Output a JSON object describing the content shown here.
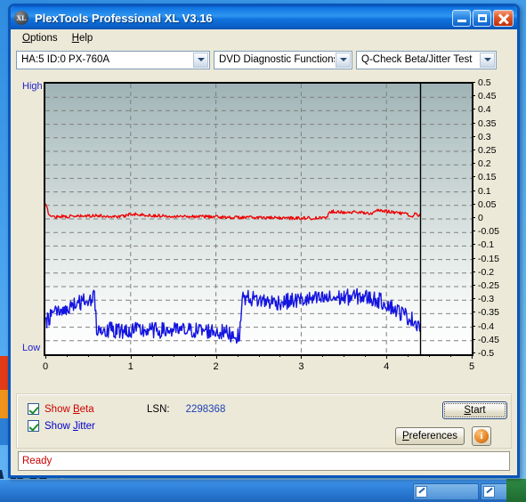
{
  "window": {
    "title": "PlexTools Professional XL V3.16",
    "app_icon": "XL",
    "minimize_title": "Minimize",
    "maximize_title": "Maximize",
    "close_title": "Close"
  },
  "menu": [
    {
      "name": "options",
      "label": "Options",
      "accel": "O"
    },
    {
      "name": "help",
      "label": "Help",
      "accel": "H"
    }
  ],
  "toolbar": {
    "drive_combo": "HA:5 ID:0  PX-760A",
    "function_combo": "DVD Diagnostic Functions",
    "test_combo": "Q-Check Beta/Jitter Test"
  },
  "chart_labels": {
    "high": "High",
    "low": "Low"
  },
  "controls": {
    "show_beta_label": "Show Beta",
    "show_beta_accel": "B",
    "show_beta_checked": true,
    "show_jitter_label": "Show Jitter",
    "show_jitter_accel": "J",
    "show_jitter_checked": true,
    "lsn_label": "LSN:",
    "lsn_value": "2298368",
    "start_label": "Start",
    "start_accel": "S",
    "preferences_label": "Preferences",
    "preferences_accel": "P",
    "info_label": "i"
  },
  "status": {
    "text": "Ready"
  },
  "colors": {
    "beta_trace": "#ee0000",
    "jitter_trace": "#1414e0",
    "axis_label": "#2222cc",
    "title_bar": "#1277e3",
    "status_text": "#cc0000"
  },
  "chart_data": {
    "type": "line",
    "title": "",
    "xlabel": "",
    "ylabel": "",
    "xlim": [
      0,
      5
    ],
    "ylim": [
      -0.5,
      0.5
    ],
    "xticks": [
      0,
      1,
      2,
      3,
      4,
      5
    ],
    "yticks": [
      0.5,
      0.45,
      0.4,
      0.35,
      0.3,
      0.25,
      0.2,
      0.15,
      0.1,
      0.05,
      0,
      -0.05,
      -0.1,
      -0.15,
      -0.2,
      -0.25,
      -0.3,
      -0.35,
      -0.4,
      -0.45,
      -0.5
    ],
    "grid": true,
    "grid_style": "dashed",
    "y_axis_left_labels": [
      "High",
      "Low"
    ],
    "data_end_marker_x": 4.4,
    "series": [
      {
        "name": "Beta",
        "color": "#ee0000",
        "x": [
          0.0,
          0.05,
          0.1,
          0.18,
          0.28,
          0.4,
          0.52,
          0.58,
          0.62,
          0.7,
          0.8,
          0.92,
          1.0,
          1.1,
          1.2,
          1.32,
          1.45,
          1.58,
          1.7,
          1.82,
          1.95,
          2.05,
          2.18,
          2.28,
          2.3,
          2.4,
          2.52,
          2.62,
          2.75,
          2.88,
          3.0,
          3.1,
          3.2,
          3.3,
          3.33,
          3.38,
          3.45,
          3.55,
          3.65,
          3.75,
          3.8,
          3.85,
          3.9,
          3.95,
          4.0,
          4.05,
          4.12,
          4.18,
          4.25,
          4.3,
          4.33,
          4.36,
          4.4
        ],
        "y": [
          0.055,
          0.012,
          0.008,
          0.01,
          0.009,
          0.01,
          0.011,
          0.014,
          0.012,
          0.01,
          0.009,
          0.01,
          0.02,
          0.016,
          0.013,
          0.012,
          0.011,
          0.01,
          0.009,
          0.01,
          0.008,
          0.007,
          0.006,
          0.006,
          0.005,
          0.006,
          0.005,
          0.004,
          0.004,
          0.003,
          0.004,
          0.003,
          0.003,
          0.004,
          0.026,
          0.028,
          0.026,
          0.025,
          0.024,
          0.023,
          0.022,
          0.021,
          0.033,
          0.03,
          0.028,
          0.026,
          0.024,
          0.021,
          0.017,
          0.003,
          0.018,
          0.015,
          0.012
        ],
        "noise_amp": 0.006
      },
      {
        "name": "Jitter",
        "color": "#1414e0",
        "x": [
          0.0,
          0.05,
          0.1,
          0.15,
          0.2,
          0.25,
          0.3,
          0.35,
          0.4,
          0.45,
          0.5,
          0.55,
          0.58,
          0.6,
          0.62,
          0.7,
          0.85,
          1.0,
          1.2,
          1.4,
          1.6,
          1.8,
          1.95,
          2.05,
          2.15,
          2.22,
          2.26,
          2.28,
          2.3,
          2.32,
          2.36,
          2.4,
          2.5,
          2.6,
          2.7,
          2.8,
          2.9,
          3.0,
          3.1,
          3.2,
          3.3,
          3.4,
          3.5,
          3.6,
          3.7,
          3.8,
          3.9,
          4.0,
          4.05,
          4.1,
          4.15,
          4.2,
          4.25,
          4.3,
          4.35,
          4.4
        ],
        "y": [
          -0.38,
          -0.362,
          -0.352,
          -0.345,
          -0.338,
          -0.33,
          -0.322,
          -0.316,
          -0.31,
          -0.305,
          -0.3,
          -0.292,
          -0.288,
          -0.4,
          -0.408,
          -0.41,
          -0.412,
          -0.412,
          -0.412,
          -0.412,
          -0.412,
          -0.412,
          -0.414,
          -0.418,
          -0.422,
          -0.428,
          -0.436,
          -0.442,
          -0.3,
          -0.292,
          -0.29,
          -0.292,
          -0.3,
          -0.304,
          -0.308,
          -0.306,
          -0.302,
          -0.3,
          -0.298,
          -0.296,
          -0.294,
          -0.292,
          -0.29,
          -0.288,
          -0.286,
          -0.292,
          -0.3,
          -0.312,
          -0.322,
          -0.334,
          -0.344,
          -0.352,
          -0.362,
          -0.372,
          -0.382,
          -0.392
        ],
        "noise_amp": 0.03
      }
    ]
  }
}
